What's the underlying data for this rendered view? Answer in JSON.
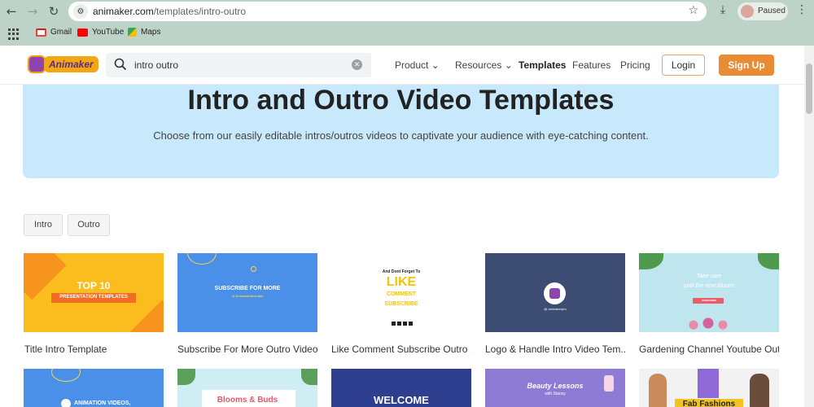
{
  "browser": {
    "url_host": "animaker.com",
    "url_path": "/templates/intro-outro",
    "profile_status": "Paused",
    "bookmarks": [
      {
        "label": "Gmail",
        "color": "#ea4335"
      },
      {
        "label": "YouTube",
        "color": "#ff0000"
      },
      {
        "label": "Maps",
        "color": "#34a853"
      }
    ]
  },
  "header": {
    "logo_text": "Animaker",
    "search_value": "intro outro",
    "nav": [
      {
        "label": "Product",
        "chevron": "⌄"
      },
      {
        "label": "Resources",
        "chevron": "⌄"
      },
      {
        "label": "Templates"
      },
      {
        "label": "Features"
      },
      {
        "label": "Pricing"
      }
    ],
    "login_label": "Login",
    "signup_label": "Sign Up",
    "accent": "#e98b32"
  },
  "hero": {
    "title": "Intro and Outro Video Templates",
    "subtitle": "Choose from our easily editable intros/outros videos to captivate your audience with eye-catching content.",
    "background": "#c8e8fb"
  },
  "filters": [
    "Intro",
    "Outro"
  ],
  "cards_row1": [
    {
      "label": "Title Intro Template",
      "thumb_lines": [
        "TOP 10",
        "PRESENTATION TEMPLATES"
      ]
    },
    {
      "label": "Subscribe For More Outro Video ...",
      "thumb_lines": [
        "SUBSCRIBE FOR MORE",
        "@ Animakertutorials"
      ]
    },
    {
      "label": "Like Comment Subscribe Outro ...",
      "thumb_lines": [
        "And Dont Forget To",
        "LIKE",
        "COMMENT",
        "SUBSCRIBE"
      ]
    },
    {
      "label": "Logo & Handle Intro Video Tem...",
      "thumb_lines": [
        "@ animakerpro"
      ]
    },
    {
      "label": "Gardening Channel Youtube Out...",
      "thumb_lines": [
        "Take care",
        "until the next bloom!",
        "SUBSCRIBE"
      ]
    }
  ],
  "cards_row2": [
    {
      "thumb_lines": [
        "ANIMATION VIDEOS,"
      ]
    },
    {
      "thumb_lines": [
        "Blooms & Buds"
      ]
    },
    {
      "thumb_lines": [
        "WELCOME"
      ]
    },
    {
      "thumb_lines": [
        "Beauty Lessons",
        "with Stacey"
      ]
    },
    {
      "thumb_lines": [
        "Fab Fashions"
      ]
    }
  ]
}
